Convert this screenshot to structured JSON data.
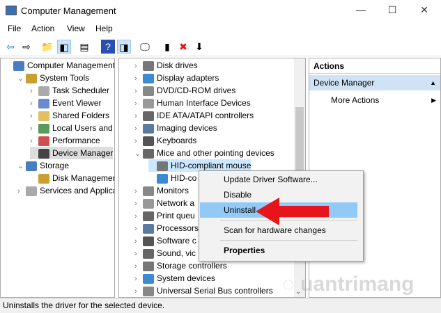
{
  "window": {
    "title": "Computer Management",
    "minimize": "—",
    "maximize": "☐",
    "close": "✕"
  },
  "menu": [
    "File",
    "Action",
    "View",
    "Help"
  ],
  "toolbar": [
    {
      "icon": "back-arrow-icon",
      "g": "⇦"
    },
    {
      "icon": "forward-arrow-icon",
      "g": "⇨"
    },
    {
      "icon": "up-folder-icon",
      "g": "📁"
    },
    {
      "icon": "show-hide-tree-icon",
      "g": "◧"
    },
    {
      "icon": "properties-icon",
      "g": "▤"
    },
    {
      "icon": "help-icon",
      "g": "?"
    },
    {
      "icon": "show-action-pane-icon",
      "g": "◨"
    },
    {
      "icon": "scan-hardware-icon",
      "g": "🖵"
    },
    {
      "icon": "update-driver-icon",
      "g": "▮"
    },
    {
      "icon": "uninstall-x-icon",
      "g": "✖"
    },
    {
      "icon": "disable-icon",
      "g": "⬇"
    }
  ],
  "left_tree": [
    {
      "label": "Computer Management (",
      "chev": "",
      "indent": 0
    },
    {
      "label": "System Tools",
      "chev": "⌄",
      "indent": 1
    },
    {
      "label": "Task Scheduler",
      "chev": "›",
      "indent": 2
    },
    {
      "label": "Event Viewer",
      "chev": "›",
      "indent": 2
    },
    {
      "label": "Shared Folders",
      "chev": "›",
      "indent": 2
    },
    {
      "label": "Local Users and Gr",
      "chev": "›",
      "indent": 2
    },
    {
      "label": "Performance",
      "chev": "›",
      "indent": 2
    },
    {
      "label": "Device Manager",
      "chev": "",
      "indent": 2,
      "selected": true
    },
    {
      "label": "Storage",
      "chev": "⌄",
      "indent": 1
    },
    {
      "label": "Disk Management",
      "chev": "",
      "indent": 2
    },
    {
      "label": "Services and Applicati",
      "chev": "›",
      "indent": 1
    }
  ],
  "device_tree": [
    {
      "label": "Disk drives",
      "chev": "›",
      "indent": 0
    },
    {
      "label": "Display adapters",
      "chev": "›",
      "indent": 0
    },
    {
      "label": "DVD/CD-ROM drives",
      "chev": "›",
      "indent": 0
    },
    {
      "label": "Human Interface Devices",
      "chev": "›",
      "indent": 0
    },
    {
      "label": "IDE ATA/ATAPI controllers",
      "chev": "›",
      "indent": 0
    },
    {
      "label": "Imaging devices",
      "chev": "›",
      "indent": 0
    },
    {
      "label": "Keyboards",
      "chev": "›",
      "indent": 0
    },
    {
      "label": "Mice and other pointing devices",
      "chev": "⌄",
      "indent": 0
    },
    {
      "label": "HID-compliant mouse",
      "chev": "",
      "indent": 1,
      "selected": true
    },
    {
      "label": "HID-co",
      "chev": "",
      "indent": 1
    },
    {
      "label": "Monitors",
      "chev": "›",
      "indent": 0
    },
    {
      "label": "Network a",
      "chev": "›",
      "indent": 0
    },
    {
      "label": "Print queu",
      "chev": "›",
      "indent": 0
    },
    {
      "label": "Processors",
      "chev": "›",
      "indent": 0
    },
    {
      "label": "Software c",
      "chev": "›",
      "indent": 0
    },
    {
      "label": "Sound, vic",
      "chev": "›",
      "indent": 0
    },
    {
      "label": "Storage controllers",
      "chev": "›",
      "indent": 0
    },
    {
      "label": "System devices",
      "chev": "›",
      "indent": 0
    },
    {
      "label": "Universal Serial Bus controllers",
      "chev": "›",
      "indent": 0
    }
  ],
  "actions": {
    "header": "Actions",
    "section": "Device Manager",
    "more": "More Actions"
  },
  "context_menu": {
    "update": "Update Driver Software...",
    "disable": "Disable",
    "uninstall": "Uninstall",
    "scan": "Scan for hardware changes",
    "properties": "Properties"
  },
  "status": "Uninstalls the driver for the selected device.",
  "watermark": "Quantrimang",
  "colors": {
    "arrow": "#e8141c",
    "highlight": "#91c9f7",
    "selected": "#cce8ff"
  }
}
